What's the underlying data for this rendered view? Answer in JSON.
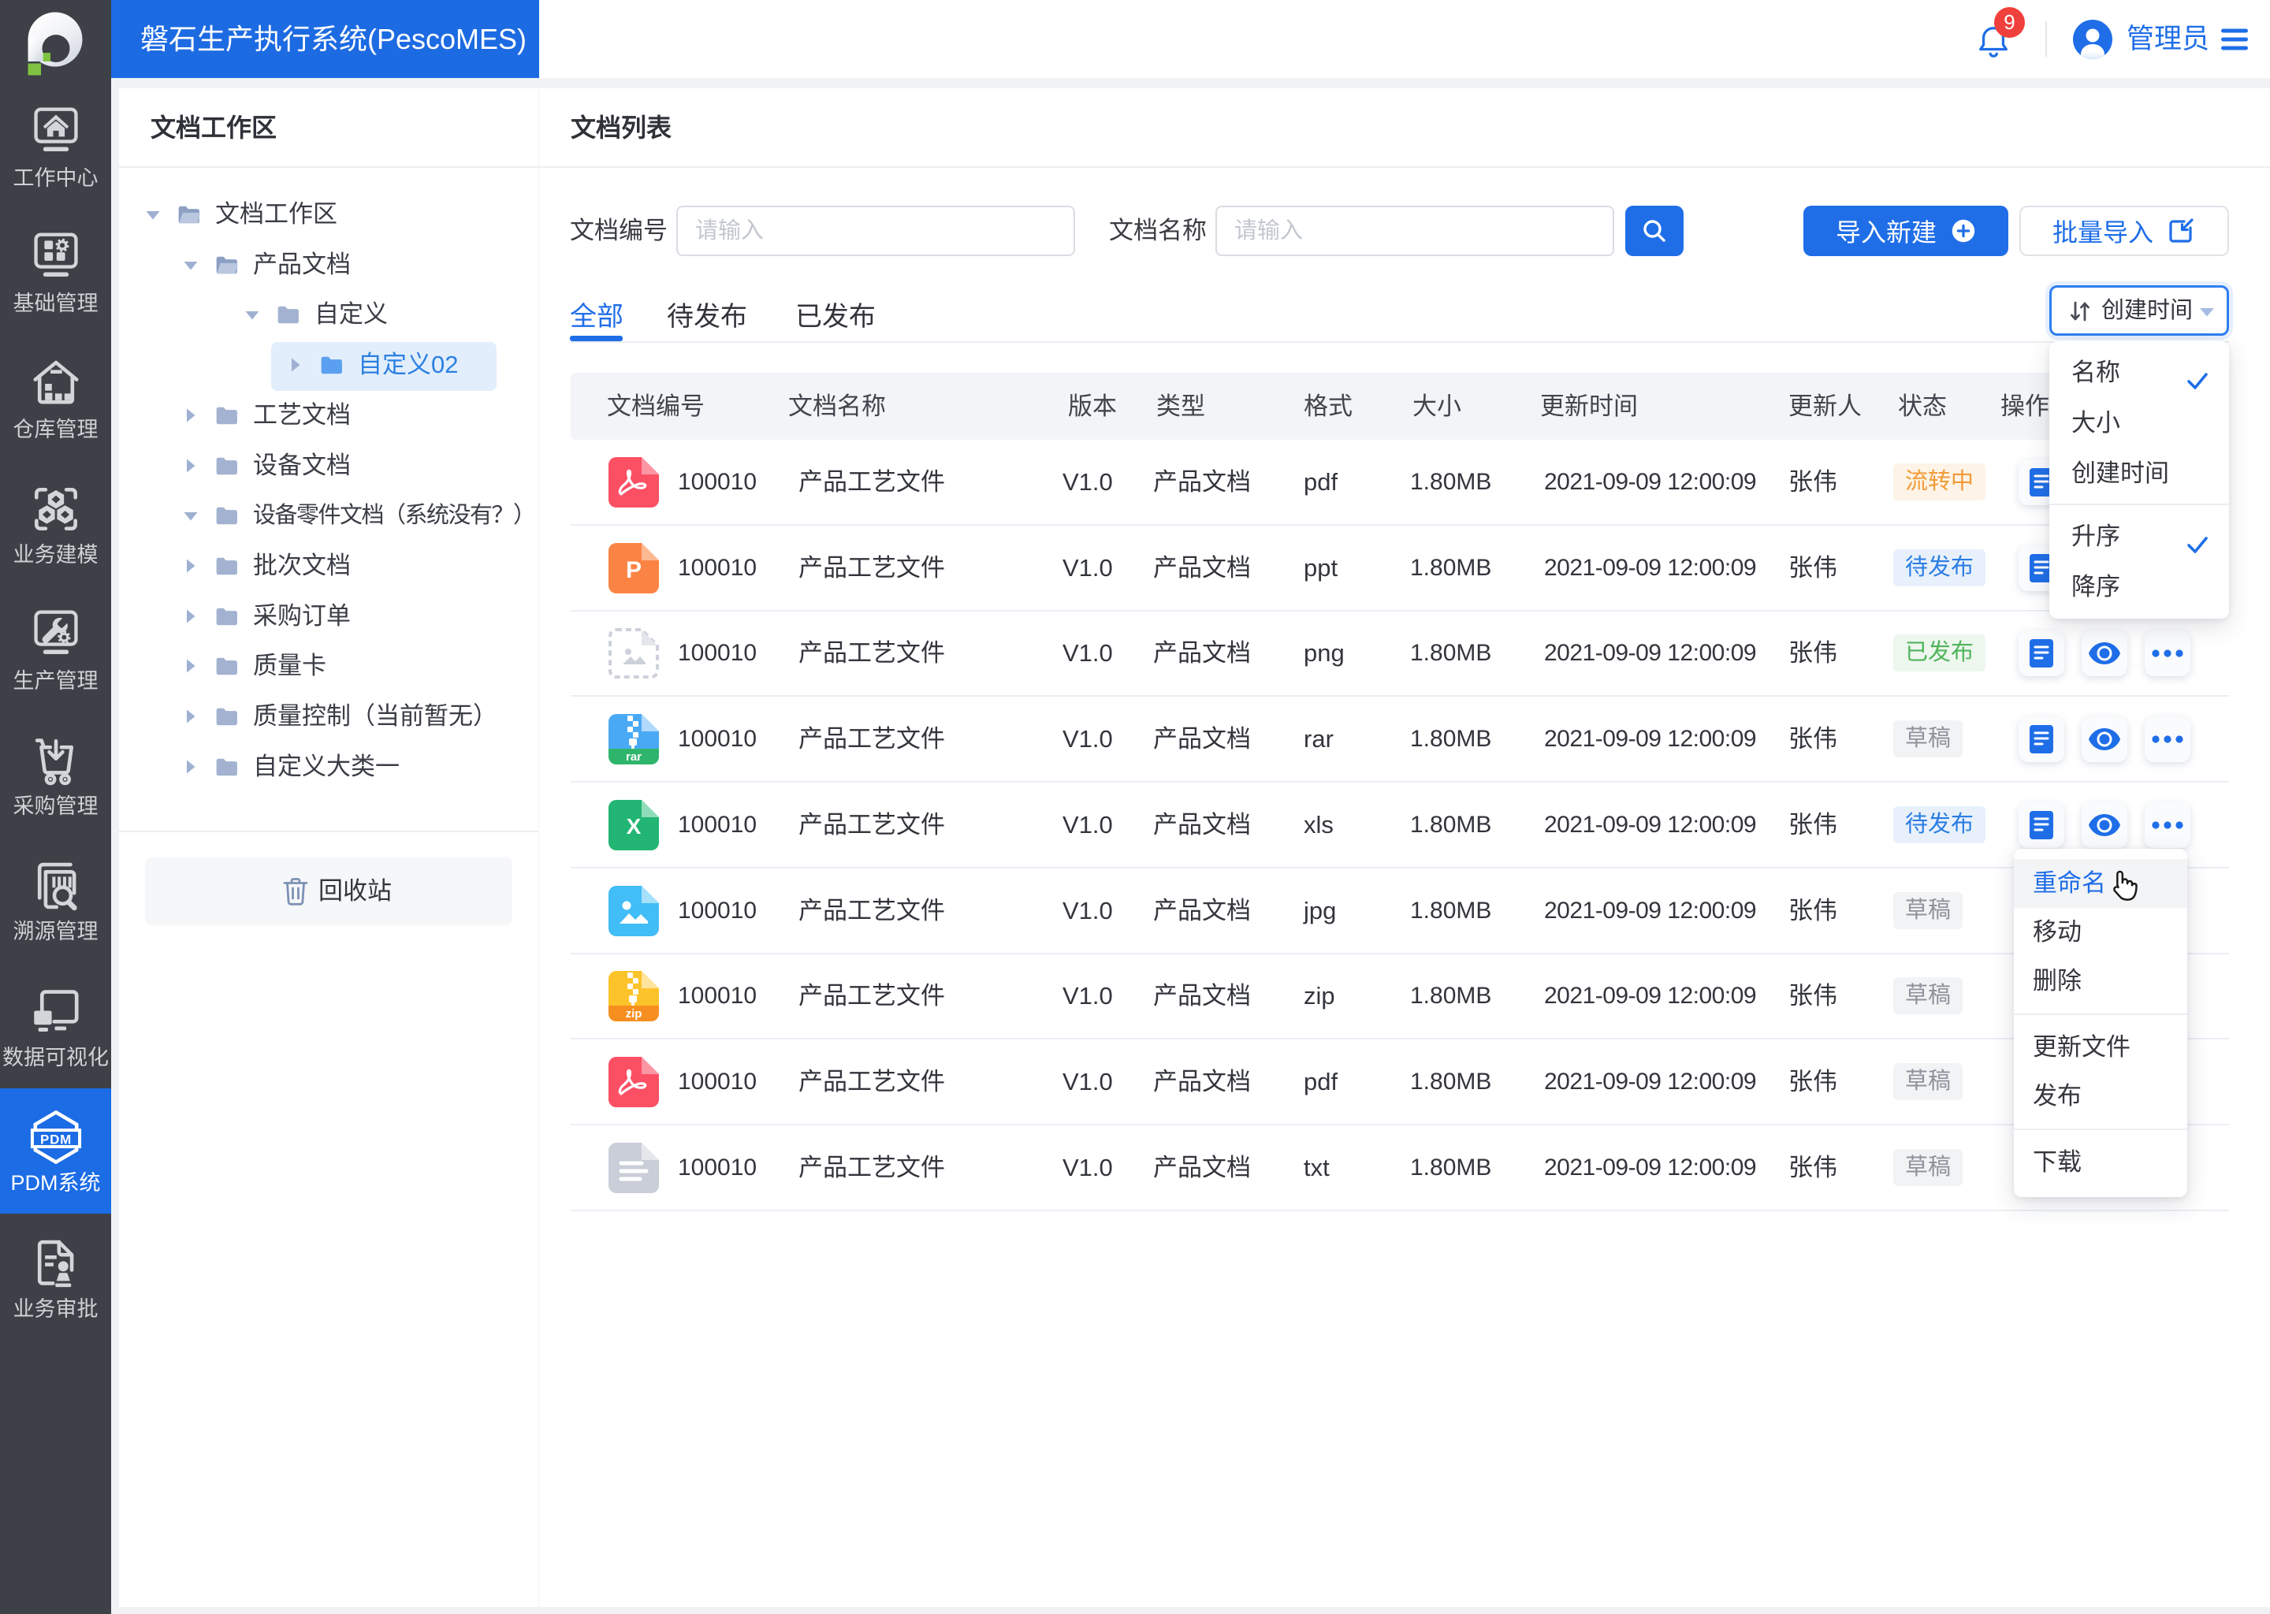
{
  "app": {
    "title": "磐石生产执行系统(PescoMES)",
    "notification_count": "9",
    "user_name": "管理员",
    "icons": {
      "bell": "bell-icon",
      "avatar": "user-avatar",
      "menu": "hamburger-icon"
    }
  },
  "sidebar": {
    "items": [
      {
        "label": "工作中心",
        "icon": "workcenter-icon",
        "active": false
      },
      {
        "label": "基础管理",
        "icon": "base-mgmt-icon",
        "active": false
      },
      {
        "label": "仓库管理",
        "icon": "warehouse-icon",
        "active": false
      },
      {
        "label": "业务建模",
        "icon": "biz-model-icon",
        "active": false
      },
      {
        "label": "生产管理",
        "icon": "production-icon",
        "active": false
      },
      {
        "label": "采购管理",
        "icon": "purchase-icon",
        "active": false
      },
      {
        "label": "溯源管理",
        "icon": "trace-icon",
        "active": false
      },
      {
        "label": "数据可视化",
        "icon": "data-vis-icon",
        "active": false
      },
      {
        "label": "PDM系统",
        "icon": "pdm-icon",
        "active": true
      },
      {
        "label": "业务审批",
        "icon": "approval-icon",
        "active": false
      }
    ]
  },
  "workspace": {
    "title": "文档工作区",
    "tree": [
      {
        "label": "文档工作区",
        "level": 0,
        "caret": "down",
        "folder": "open",
        "selected": false
      },
      {
        "label": "产品文档",
        "level": 1,
        "caret": "down",
        "folder": "open",
        "selected": false
      },
      {
        "label": "自定义",
        "level": 2,
        "caret": "down",
        "folder": "closed",
        "selected": false
      },
      {
        "label": "自定义02",
        "level": 3,
        "caret": "right",
        "folder": "closed",
        "selected": true
      },
      {
        "label": "工艺文档",
        "level": 1,
        "caret": "right",
        "folder": "closed",
        "selected": false
      },
      {
        "label": "设备文档",
        "level": 1,
        "caret": "right",
        "folder": "closed",
        "selected": false
      },
      {
        "label": "设备零件文档（系统没有？）",
        "level": 1,
        "caret": "down",
        "folder": "closed",
        "selected": false
      },
      {
        "label": "批次文档",
        "level": 1,
        "caret": "right",
        "folder": "closed",
        "selected": false
      },
      {
        "label": "采购订单",
        "level": 1,
        "caret": "right",
        "folder": "closed",
        "selected": false
      },
      {
        "label": "质量卡",
        "level": 1,
        "caret": "right",
        "folder": "closed",
        "selected": false
      },
      {
        "label": "质量控制（当前暂无）",
        "level": 1,
        "caret": "right",
        "folder": "closed",
        "selected": false
      },
      {
        "label": "自定义大类一",
        "level": 1,
        "caret": "right",
        "folder": "closed",
        "selected": false
      }
    ],
    "recycle_label": "回收站"
  },
  "main": {
    "title": "文档列表",
    "filters": {
      "doc_no_label": "文档编号",
      "doc_no_placeholder": "请输入",
      "doc_name_label": "文档名称",
      "doc_name_placeholder": "请输入"
    },
    "actions": {
      "import_new": "导入新建",
      "batch_import": "批量导入"
    },
    "tabs": [
      {
        "label": "全部",
        "active": true
      },
      {
        "label": "待发布",
        "active": false
      },
      {
        "label": "已发布",
        "active": false
      }
    ],
    "sort": {
      "button_label": "创建时间",
      "menu": [
        {
          "label": "名称",
          "checked": true
        },
        {
          "label": "大小",
          "checked": false
        },
        {
          "label": "创建时间",
          "checked": false
        },
        {
          "label": "升序",
          "checked": true
        },
        {
          "label": "降序",
          "checked": false
        }
      ]
    },
    "table": {
      "columns": [
        "文档编号",
        "文档名称",
        "版本",
        "类型",
        "格式",
        "大小",
        "更新时间",
        "更新人",
        "状态",
        "操作"
      ],
      "rows": [
        {
          "doc_no": "100010",
          "name": "产品工艺文件",
          "version": "V1.0",
          "type": "产品文档",
          "format": "pdf",
          "size": "1.80MB",
          "updated": "2021-09-09 12:00:09",
          "updater": "张伟",
          "status": "流转中",
          "status_type": "flow"
        },
        {
          "doc_no": "100010",
          "name": "产品工艺文件",
          "version": "V1.0",
          "type": "产品文档",
          "format": "ppt",
          "size": "1.80MB",
          "updated": "2021-09-09 12:00:09",
          "updater": "张伟",
          "status": "待发布",
          "status_type": "pending"
        },
        {
          "doc_no": "100010",
          "name": "产品工艺文件",
          "version": "V1.0",
          "type": "产品文档",
          "format": "png",
          "size": "1.80MB",
          "updated": "2021-09-09 12:00:09",
          "updater": "张伟",
          "status": "已发布",
          "status_type": "published"
        },
        {
          "doc_no": "100010",
          "name": "产品工艺文件",
          "version": "V1.0",
          "type": "产品文档",
          "format": "rar",
          "size": "1.80MB",
          "updated": "2021-09-09 12:00:09",
          "updater": "张伟",
          "status": "草稿",
          "status_type": "draft"
        },
        {
          "doc_no": "100010",
          "name": "产品工艺文件",
          "version": "V1.0",
          "type": "产品文档",
          "format": "xls",
          "size": "1.80MB",
          "updated": "2021-09-09 12:00:09",
          "updater": "张伟",
          "status": "待发布",
          "status_type": "pending"
        },
        {
          "doc_no": "100010",
          "name": "产品工艺文件",
          "version": "V1.0",
          "type": "产品文档",
          "format": "jpg",
          "size": "1.80MB",
          "updated": "2021-09-09 12:00:09",
          "updater": "张伟",
          "status": "草稿",
          "status_type": "draft"
        },
        {
          "doc_no": "100010",
          "name": "产品工艺文件",
          "version": "V1.0",
          "type": "产品文档",
          "format": "zip",
          "size": "1.80MB",
          "updated": "2021-09-09 12:00:09",
          "updater": "张伟",
          "status": "草稿",
          "status_type": "draft"
        },
        {
          "doc_no": "100010",
          "name": "产品工艺文件",
          "version": "V1.0",
          "type": "产品文档",
          "format": "pdf",
          "size": "1.80MB",
          "updated": "2021-09-09 12:00:09",
          "updater": "张伟",
          "status": "草稿",
          "status_type": "draft"
        },
        {
          "doc_no": "100010",
          "name": "产品工艺文件",
          "version": "V1.0",
          "type": "产品文档",
          "format": "txt",
          "size": "1.80MB",
          "updated": "2021-09-09 12:00:09",
          "updater": "张伟",
          "status": "草稿",
          "status_type": "draft"
        }
      ]
    },
    "context_menu": {
      "items": [
        {
          "label": "重命名",
          "active": true
        },
        {
          "label": "移动",
          "active": false
        },
        {
          "label": "删除",
          "active": false
        },
        {
          "label": "更新文件",
          "active": false
        },
        {
          "label": "发布",
          "active": false
        },
        {
          "label": "下载",
          "active": false
        }
      ]
    }
  },
  "colors": {
    "primary": "#1f6ee8",
    "sidebar_bg": "#3b3e44",
    "page_bg": "#f0f2f5",
    "status_flow": "#f29b38",
    "status_pending": "#2b7de3",
    "status_published": "#4fb45a",
    "status_draft": "#8f929b"
  }
}
